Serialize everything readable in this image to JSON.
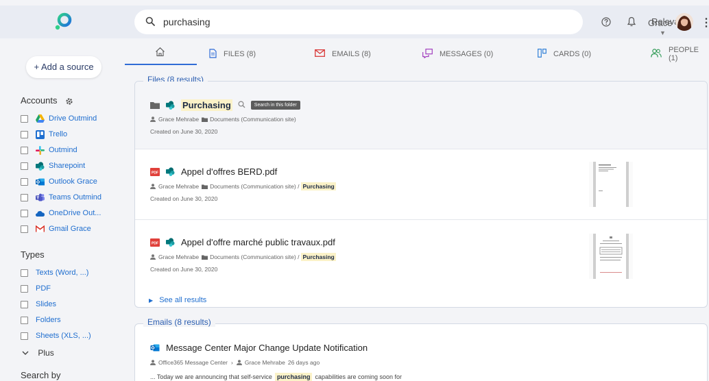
{
  "colors": {
    "accent": "#2f6bd6",
    "highlight": "#fbf2c8",
    "email_red": "#d93a3a",
    "messages_purple": "#a23fbf",
    "cards_blue": "#2f7fd6",
    "people_green": "#2f9a55"
  },
  "header": {
    "search_value": "purchasing",
    "sort_label": "Relevance",
    "user_name": "Grace",
    "icons": [
      "search-icon",
      "help-icon",
      "bell-icon",
      "kebab-menu-icon"
    ]
  },
  "sidebar": {
    "add_source_label": "+ Add a source",
    "accounts_title": "Accounts",
    "accounts": [
      {
        "label": "Drive Outmind",
        "icon": "google-drive-icon"
      },
      {
        "label": "Trello",
        "icon": "trello-icon"
      },
      {
        "label": "Outmind",
        "icon": "slack-icon"
      },
      {
        "label": "Sharepoint",
        "icon": "sharepoint-icon"
      },
      {
        "label": "Outlook Grace",
        "icon": "outlook-icon"
      },
      {
        "label": "Teams Outmind",
        "icon": "teams-icon"
      },
      {
        "label": "OneDrive Out...",
        "icon": "onedrive-icon"
      },
      {
        "label": "Gmail Grace",
        "icon": "gmail-icon"
      }
    ],
    "types_title": "Types",
    "types": [
      "Texts (Word, ...)",
      "PDF",
      "Slides",
      "Folders",
      "Sheets (XLS, ...)"
    ],
    "plus_label": "Plus",
    "search_by_title": "Search by"
  },
  "tabs": [
    {
      "label": "",
      "icon": "home-icon"
    },
    {
      "label": "FILES (8)",
      "icon": "file-icon"
    },
    {
      "label": "EMAILS (8)",
      "icon": "email-icon"
    },
    {
      "label": "MESSAGES (0)",
      "icon": "messages-icon"
    },
    {
      "label": "CARDS (0)",
      "icon": "cards-icon"
    },
    {
      "label": "PEOPLE (1)",
      "icon": "people-icon"
    }
  ],
  "files_group": {
    "title": "Files (8 results)",
    "results": [
      {
        "title": "Purchasing",
        "tooltip": "Search in this folder",
        "author": "Grace Mehrabe",
        "location": "Documents (Communication site)",
        "created": "Created on June 30, 2020"
      },
      {
        "title": "Appel d'offres BERD.pdf",
        "author": "Grace Mehrabe",
        "location": "Documents (Communication site) /",
        "location_highlight": "Purchasing",
        "created": "Created on June 30, 2020"
      },
      {
        "title": "Appel d'offre marché public travaux.pdf",
        "author": "Grace Mehrabe",
        "location": "Documents (Communication site) /",
        "location_highlight": "Purchasing",
        "created": "Created on June 30, 2020"
      }
    ],
    "see_all_label": "See all results"
  },
  "emails_group": {
    "title": "Emails (8 results)",
    "results": [
      {
        "title": "Message Center Major Change Update Notification",
        "sender": "Office365 Message Center",
        "recipient": "Grace Mehrabe",
        "age": "26 days ago",
        "snippet_before": "... Today we are announcing that self-service",
        "snippet_highlight": "purchasing",
        "snippet_after": "capabilities are coming soon for"
      }
    ]
  }
}
